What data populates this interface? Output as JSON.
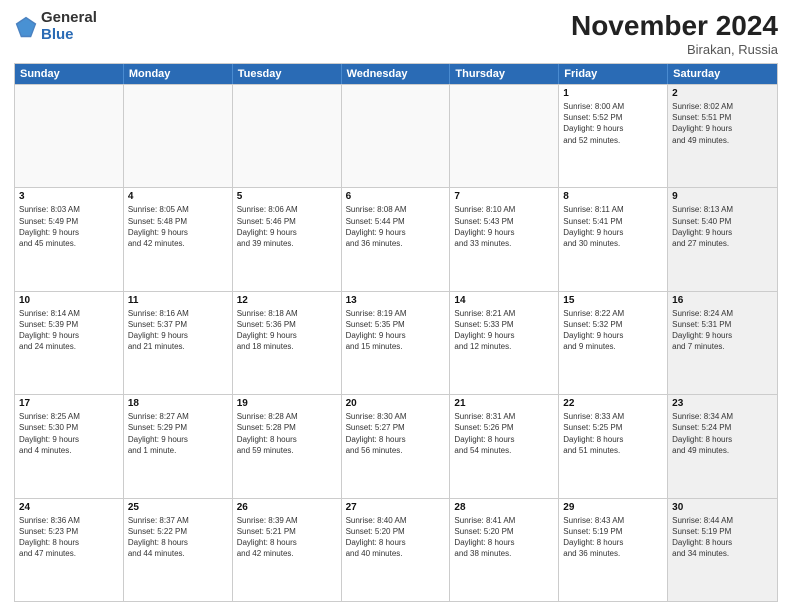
{
  "header": {
    "logo_general": "General",
    "logo_blue": "Blue",
    "month_title": "November 2024",
    "location": "Birakan, Russia"
  },
  "days_of_week": [
    "Sunday",
    "Monday",
    "Tuesday",
    "Wednesday",
    "Thursday",
    "Friday",
    "Saturday"
  ],
  "rows": [
    [
      {
        "day": "",
        "info": "",
        "shaded": false,
        "empty": true
      },
      {
        "day": "",
        "info": "",
        "shaded": false,
        "empty": true
      },
      {
        "day": "",
        "info": "",
        "shaded": false,
        "empty": true
      },
      {
        "day": "",
        "info": "",
        "shaded": false,
        "empty": true
      },
      {
        "day": "",
        "info": "",
        "shaded": false,
        "empty": true
      },
      {
        "day": "1",
        "info": "Sunrise: 8:00 AM\nSunset: 5:52 PM\nDaylight: 9 hours\nand 52 minutes.",
        "shaded": false,
        "empty": false
      },
      {
        "day": "2",
        "info": "Sunrise: 8:02 AM\nSunset: 5:51 PM\nDaylight: 9 hours\nand 49 minutes.",
        "shaded": true,
        "empty": false
      }
    ],
    [
      {
        "day": "3",
        "info": "Sunrise: 8:03 AM\nSunset: 5:49 PM\nDaylight: 9 hours\nand 45 minutes.",
        "shaded": false,
        "empty": false
      },
      {
        "day": "4",
        "info": "Sunrise: 8:05 AM\nSunset: 5:48 PM\nDaylight: 9 hours\nand 42 minutes.",
        "shaded": false,
        "empty": false
      },
      {
        "day": "5",
        "info": "Sunrise: 8:06 AM\nSunset: 5:46 PM\nDaylight: 9 hours\nand 39 minutes.",
        "shaded": false,
        "empty": false
      },
      {
        "day": "6",
        "info": "Sunrise: 8:08 AM\nSunset: 5:44 PM\nDaylight: 9 hours\nand 36 minutes.",
        "shaded": false,
        "empty": false
      },
      {
        "day": "7",
        "info": "Sunrise: 8:10 AM\nSunset: 5:43 PM\nDaylight: 9 hours\nand 33 minutes.",
        "shaded": false,
        "empty": false
      },
      {
        "day": "8",
        "info": "Sunrise: 8:11 AM\nSunset: 5:41 PM\nDaylight: 9 hours\nand 30 minutes.",
        "shaded": false,
        "empty": false
      },
      {
        "day": "9",
        "info": "Sunrise: 8:13 AM\nSunset: 5:40 PM\nDaylight: 9 hours\nand 27 minutes.",
        "shaded": true,
        "empty": false
      }
    ],
    [
      {
        "day": "10",
        "info": "Sunrise: 8:14 AM\nSunset: 5:39 PM\nDaylight: 9 hours\nand 24 minutes.",
        "shaded": false,
        "empty": false
      },
      {
        "day": "11",
        "info": "Sunrise: 8:16 AM\nSunset: 5:37 PM\nDaylight: 9 hours\nand 21 minutes.",
        "shaded": false,
        "empty": false
      },
      {
        "day": "12",
        "info": "Sunrise: 8:18 AM\nSunset: 5:36 PM\nDaylight: 9 hours\nand 18 minutes.",
        "shaded": false,
        "empty": false
      },
      {
        "day": "13",
        "info": "Sunrise: 8:19 AM\nSunset: 5:35 PM\nDaylight: 9 hours\nand 15 minutes.",
        "shaded": false,
        "empty": false
      },
      {
        "day": "14",
        "info": "Sunrise: 8:21 AM\nSunset: 5:33 PM\nDaylight: 9 hours\nand 12 minutes.",
        "shaded": false,
        "empty": false
      },
      {
        "day": "15",
        "info": "Sunrise: 8:22 AM\nSunset: 5:32 PM\nDaylight: 9 hours\nand 9 minutes.",
        "shaded": false,
        "empty": false
      },
      {
        "day": "16",
        "info": "Sunrise: 8:24 AM\nSunset: 5:31 PM\nDaylight: 9 hours\nand 7 minutes.",
        "shaded": true,
        "empty": false
      }
    ],
    [
      {
        "day": "17",
        "info": "Sunrise: 8:25 AM\nSunset: 5:30 PM\nDaylight: 9 hours\nand 4 minutes.",
        "shaded": false,
        "empty": false
      },
      {
        "day": "18",
        "info": "Sunrise: 8:27 AM\nSunset: 5:29 PM\nDaylight: 9 hours\nand 1 minute.",
        "shaded": false,
        "empty": false
      },
      {
        "day": "19",
        "info": "Sunrise: 8:28 AM\nSunset: 5:28 PM\nDaylight: 8 hours\nand 59 minutes.",
        "shaded": false,
        "empty": false
      },
      {
        "day": "20",
        "info": "Sunrise: 8:30 AM\nSunset: 5:27 PM\nDaylight: 8 hours\nand 56 minutes.",
        "shaded": false,
        "empty": false
      },
      {
        "day": "21",
        "info": "Sunrise: 8:31 AM\nSunset: 5:26 PM\nDaylight: 8 hours\nand 54 minutes.",
        "shaded": false,
        "empty": false
      },
      {
        "day": "22",
        "info": "Sunrise: 8:33 AM\nSunset: 5:25 PM\nDaylight: 8 hours\nand 51 minutes.",
        "shaded": false,
        "empty": false
      },
      {
        "day": "23",
        "info": "Sunrise: 8:34 AM\nSunset: 5:24 PM\nDaylight: 8 hours\nand 49 minutes.",
        "shaded": true,
        "empty": false
      }
    ],
    [
      {
        "day": "24",
        "info": "Sunrise: 8:36 AM\nSunset: 5:23 PM\nDaylight: 8 hours\nand 47 minutes.",
        "shaded": false,
        "empty": false
      },
      {
        "day": "25",
        "info": "Sunrise: 8:37 AM\nSunset: 5:22 PM\nDaylight: 8 hours\nand 44 minutes.",
        "shaded": false,
        "empty": false
      },
      {
        "day": "26",
        "info": "Sunrise: 8:39 AM\nSunset: 5:21 PM\nDaylight: 8 hours\nand 42 minutes.",
        "shaded": false,
        "empty": false
      },
      {
        "day": "27",
        "info": "Sunrise: 8:40 AM\nSunset: 5:20 PM\nDaylight: 8 hours\nand 40 minutes.",
        "shaded": false,
        "empty": false
      },
      {
        "day": "28",
        "info": "Sunrise: 8:41 AM\nSunset: 5:20 PM\nDaylight: 8 hours\nand 38 minutes.",
        "shaded": false,
        "empty": false
      },
      {
        "day": "29",
        "info": "Sunrise: 8:43 AM\nSunset: 5:19 PM\nDaylight: 8 hours\nand 36 minutes.",
        "shaded": false,
        "empty": false
      },
      {
        "day": "30",
        "info": "Sunrise: 8:44 AM\nSunset: 5:19 PM\nDaylight: 8 hours\nand 34 minutes.",
        "shaded": true,
        "empty": false
      }
    ]
  ]
}
